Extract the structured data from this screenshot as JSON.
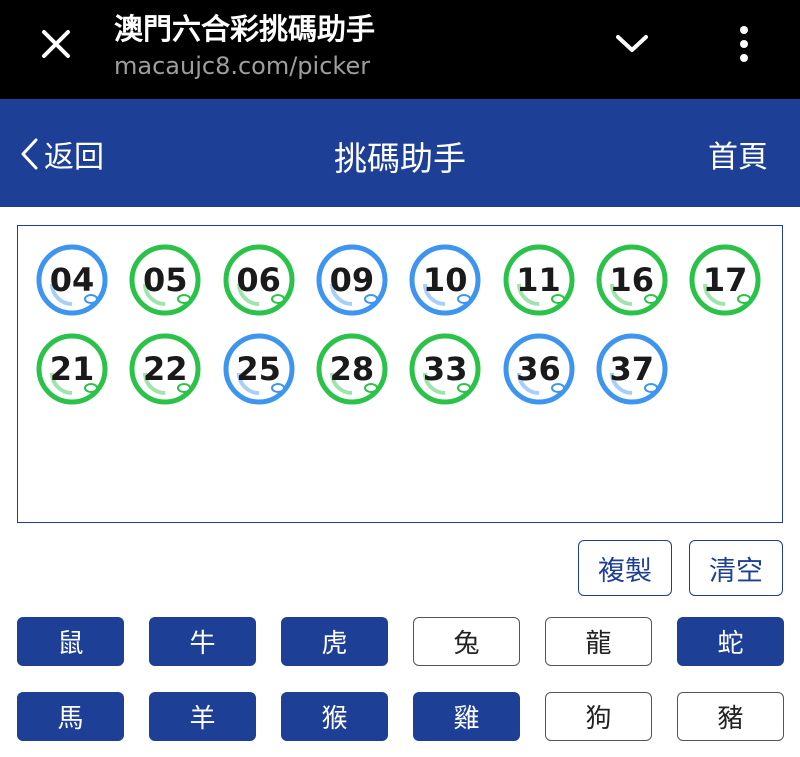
{
  "browser": {
    "title": "澳門六合彩挑碼助手",
    "url": "macaujc8.com/picker"
  },
  "header": {
    "back_label": "返回",
    "title": "挑碼助手",
    "home_label": "首頁"
  },
  "colors": {
    "primary": "#1d3f96",
    "ball_green": "#2bc24a",
    "ball_blue": "#3d95f0"
  },
  "selected_numbers": [
    {
      "num": "04",
      "color": "blue"
    },
    {
      "num": "05",
      "color": "green"
    },
    {
      "num": "06",
      "color": "green"
    },
    {
      "num": "09",
      "color": "blue"
    },
    {
      "num": "10",
      "color": "blue"
    },
    {
      "num": "11",
      "color": "green"
    },
    {
      "num": "16",
      "color": "green"
    },
    {
      "num": "17",
      "color": "green"
    },
    {
      "num": "21",
      "color": "green"
    },
    {
      "num": "22",
      "color": "green"
    },
    {
      "num": "25",
      "color": "blue"
    },
    {
      "num": "28",
      "color": "green"
    },
    {
      "num": "33",
      "color": "green"
    },
    {
      "num": "36",
      "color": "blue"
    },
    {
      "num": "37",
      "color": "blue"
    }
  ],
  "actions": {
    "copy_label": "複製",
    "clear_label": "清空"
  },
  "zodiacs": [
    {
      "label": "鼠",
      "selected": true
    },
    {
      "label": "牛",
      "selected": true
    },
    {
      "label": "虎",
      "selected": true
    },
    {
      "label": "兔",
      "selected": false
    },
    {
      "label": "龍",
      "selected": false
    },
    {
      "label": "蛇",
      "selected": true
    },
    {
      "label": "馬",
      "selected": true
    },
    {
      "label": "羊",
      "selected": true
    },
    {
      "label": "猴",
      "selected": true
    },
    {
      "label": "雞",
      "selected": true
    },
    {
      "label": "狗",
      "selected": false
    },
    {
      "label": "豬",
      "selected": false
    }
  ]
}
